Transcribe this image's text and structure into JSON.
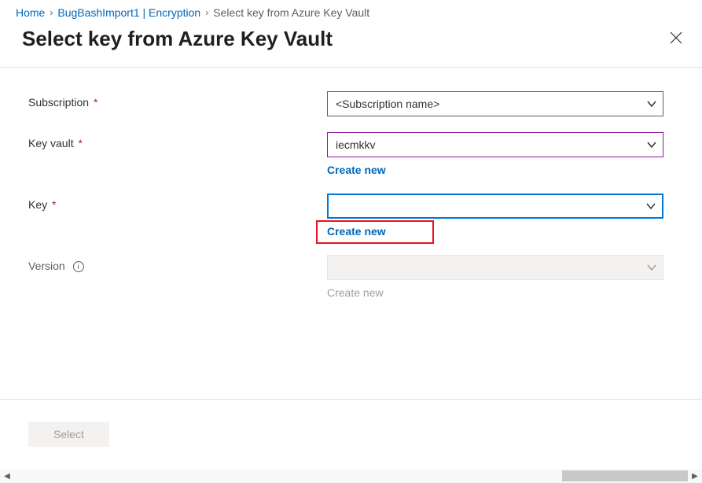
{
  "breadcrumb": {
    "home": "Home",
    "item2": "BugBashImport1 | Encryption",
    "current": "Select key from Azure Key Vault"
  },
  "page": {
    "title": "Select key from Azure Key Vault"
  },
  "form": {
    "subscription": {
      "label": "Subscription",
      "value": "<Subscription name>"
    },
    "keyvault": {
      "label": "Key vault",
      "value": "iecmkkv",
      "create": "Create new"
    },
    "key": {
      "label": "Key",
      "value": "",
      "create": "Create new"
    },
    "version": {
      "label": "Version",
      "value": "",
      "create": "Create new"
    }
  },
  "actions": {
    "select": "Select"
  }
}
